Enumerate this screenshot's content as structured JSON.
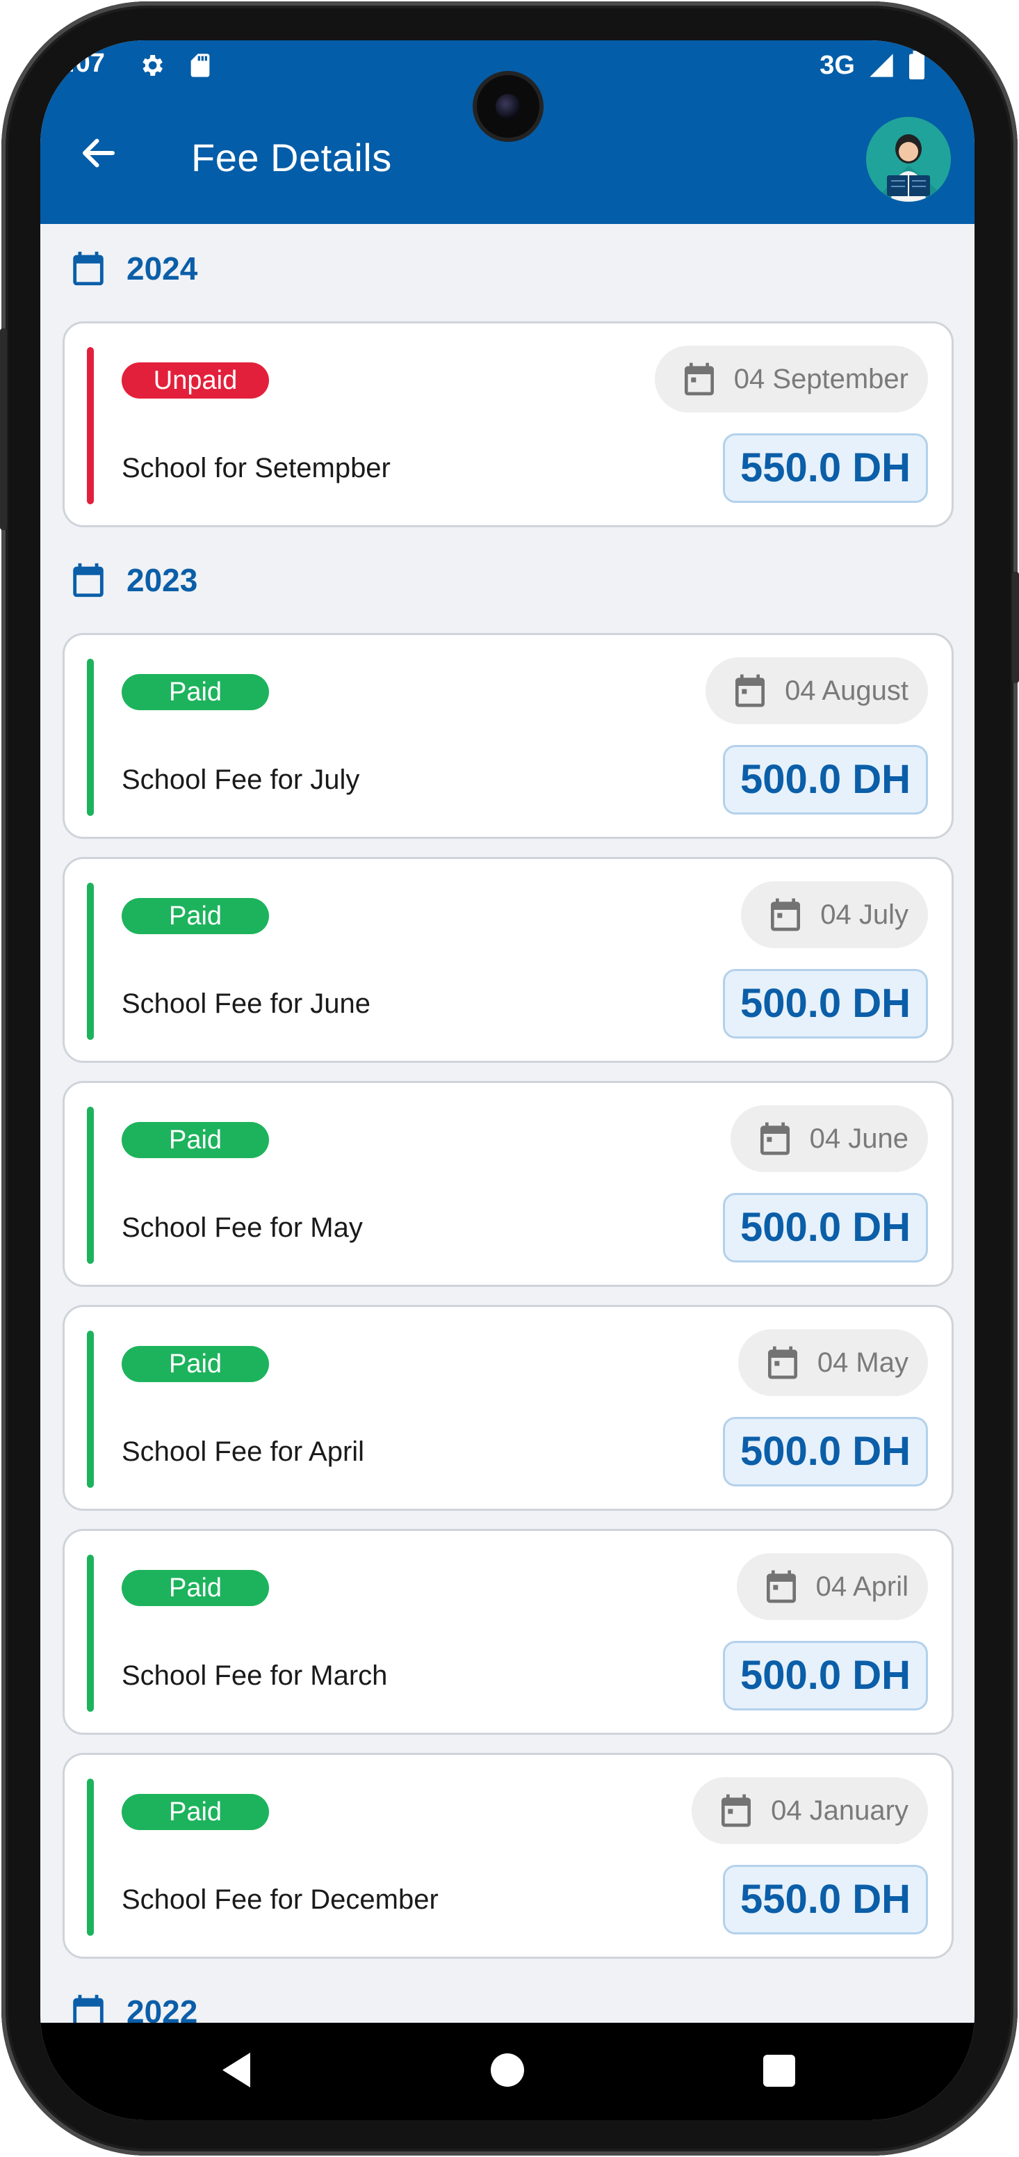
{
  "status_bar": {
    "time": ":07",
    "network": "3G"
  },
  "app_bar": {
    "title": "Fee Details"
  },
  "sections": [
    {
      "year": "2024",
      "fees": [
        {
          "status": "Unpaid",
          "status_color": "#e3203b",
          "date": "04 September",
          "description": "School for Setempber",
          "amount": "550.0 DH"
        }
      ]
    },
    {
      "year": "2023",
      "fees": [
        {
          "status": "Paid",
          "status_color": "#1db35c",
          "date": "04 August",
          "description": "School Fee for July",
          "amount": "500.0 DH"
        },
        {
          "status": "Paid",
          "status_color": "#1db35c",
          "date": "04 July",
          "description": "School Fee for June",
          "amount": "500.0 DH"
        },
        {
          "status": "Paid",
          "status_color": "#1db35c",
          "date": "04 June",
          "description": "School Fee for May",
          "amount": "500.0 DH"
        },
        {
          "status": "Paid",
          "status_color": "#1db35c",
          "date": "04 May",
          "description": "School Fee for April",
          "amount": "500.0 DH"
        },
        {
          "status": "Paid",
          "status_color": "#1db35c",
          "date": "04 April",
          "description": "School Fee for March",
          "amount": "500.0 DH"
        },
        {
          "status": "Paid",
          "status_color": "#1db35c",
          "date": "04 January",
          "description": "School Fee for December",
          "amount": "550.0 DH"
        }
      ]
    },
    {
      "year": "2022",
      "fees": []
    }
  ],
  "colors": {
    "app_bar": "#045da8",
    "accent": "#0b5ea8",
    "paid": "#1db35c",
    "unpaid": "#e3203b"
  },
  "icons": [
    "settings-icon",
    "sd-card-icon",
    "signal-icon",
    "battery-icon",
    "back-arrow-icon",
    "avatar-icon",
    "calendar-icon",
    "nav-back-icon",
    "nav-home-icon",
    "nav-recents-icon"
  ]
}
